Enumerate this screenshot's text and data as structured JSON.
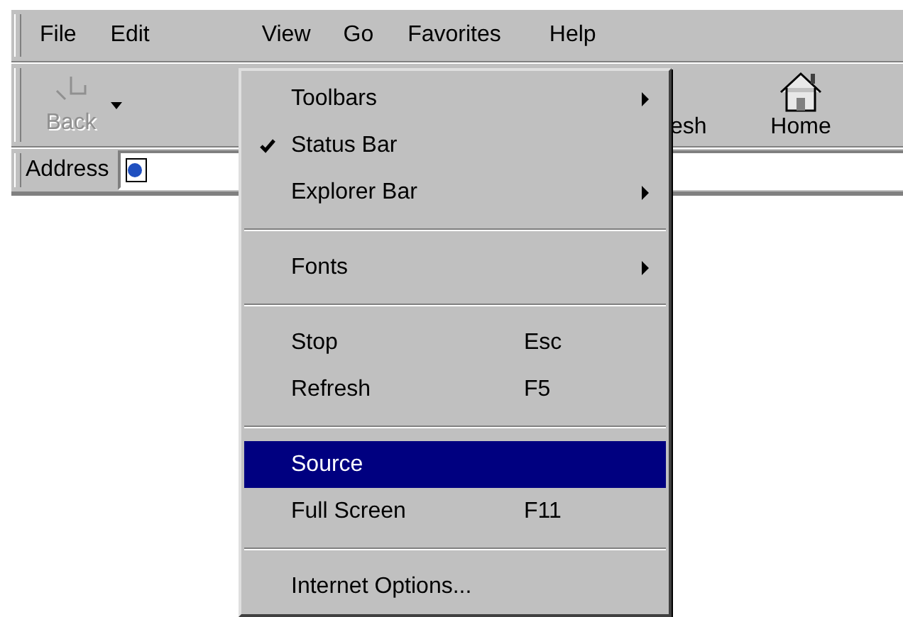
{
  "menu_bar": [
    {
      "label": "File",
      "selected": false
    },
    {
      "label": "Edit",
      "selected": false
    },
    {
      "label": "View",
      "selected": true
    },
    {
      "label": "Go",
      "selected": false
    },
    {
      "label": "Favorites",
      "selected": false
    },
    {
      "label": "Help",
      "selected": false
    }
  ],
  "toolbar": [
    {
      "kind": "back",
      "label": "Back",
      "disabled": true
    },
    {
      "kind": "refresh",
      "label": "esh",
      "disabled": false
    },
    {
      "kind": "home",
      "label": "Home",
      "disabled": false
    }
  ],
  "address_bar": {
    "label": "Address"
  },
  "view_menu": [
    {
      "kind": "item",
      "label": "Toolbars",
      "submenu": true,
      "checked": false,
      "selected": false
    },
    {
      "kind": "item",
      "label": "Status Bar",
      "submenu": false,
      "checked": true,
      "selected": false
    },
    {
      "kind": "item",
      "label": "Explorer Bar",
      "submenu": true,
      "checked": false,
      "selected": false
    },
    {
      "kind": "separator"
    },
    {
      "kind": "item",
      "label": "Fonts",
      "submenu": true,
      "checked": false,
      "selected": false
    },
    {
      "kind": "separator"
    },
    {
      "kind": "item",
      "label": "Stop",
      "shortcut": "Esc",
      "submenu": false,
      "checked": false,
      "selected": false
    },
    {
      "kind": "item",
      "label": "Refresh",
      "shortcut": "F5",
      "submenu": false,
      "checked": false,
      "selected": false
    },
    {
      "kind": "separator"
    },
    {
      "kind": "item",
      "label": "Source",
      "submenu": false,
      "checked": false,
      "selected": true
    },
    {
      "kind": "item",
      "label": "Full Screen",
      "shortcut": "F11",
      "submenu": false,
      "checked": false,
      "selected": false
    },
    {
      "kind": "separator"
    },
    {
      "kind": "item",
      "label": "Internet Options...",
      "submenu": false,
      "checked": false,
      "selected": false
    }
  ]
}
